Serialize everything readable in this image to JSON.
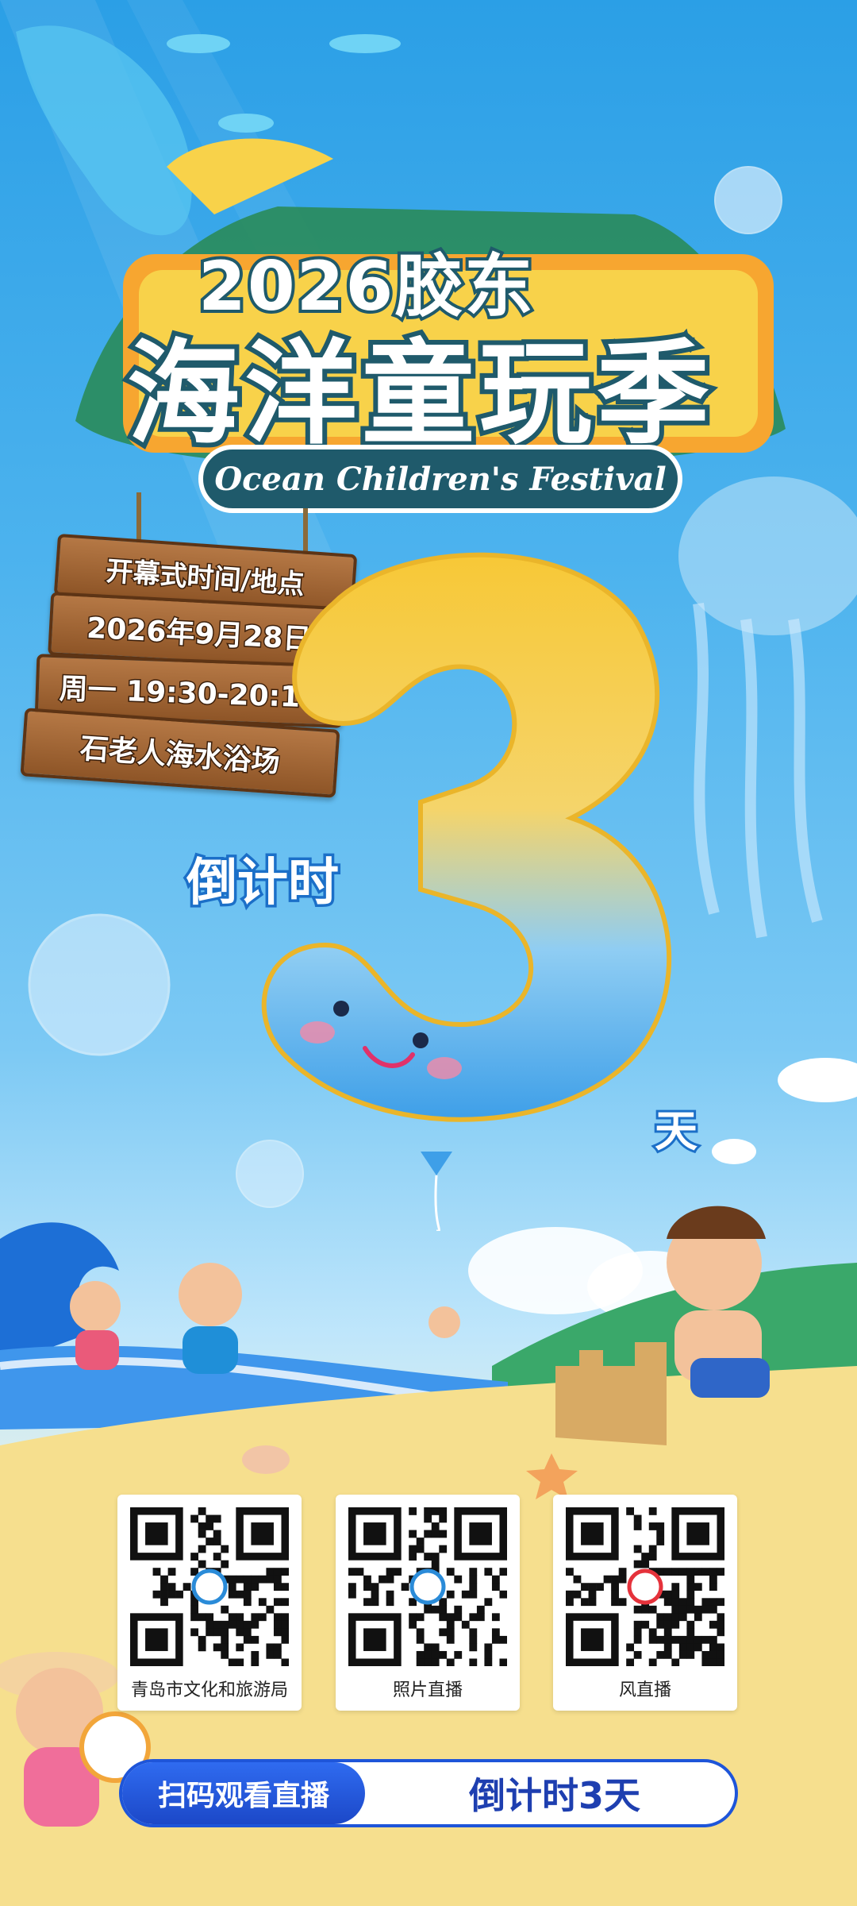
{
  "title": {
    "year_line": "2026胶东",
    "main_line": "海洋童玩季",
    "english": "Ocean Children's Festival"
  },
  "sign": {
    "heading": "开幕式时间/地点",
    "date": "2026年9月28日",
    "time": "周一 19:30-20:10",
    "location": "石老人海水浴场"
  },
  "countdown": {
    "label": "倒计时",
    "number": "3",
    "unit": "天"
  },
  "qr_codes": [
    {
      "label": "青岛市文化和旅游局"
    },
    {
      "label": "照片直播"
    },
    {
      "label": "风直播"
    }
  ],
  "cta": {
    "left": "扫码观看直播",
    "right": "倒计时3天"
  },
  "colors": {
    "sky_top": "#2b9fe6",
    "sand": "#f8de86",
    "title_outline": "#1f5a6b",
    "cta_blue": "#1e55d9",
    "balloon_yellow": "#f6c93a",
    "balloon_blue": "#5ab4ef"
  }
}
